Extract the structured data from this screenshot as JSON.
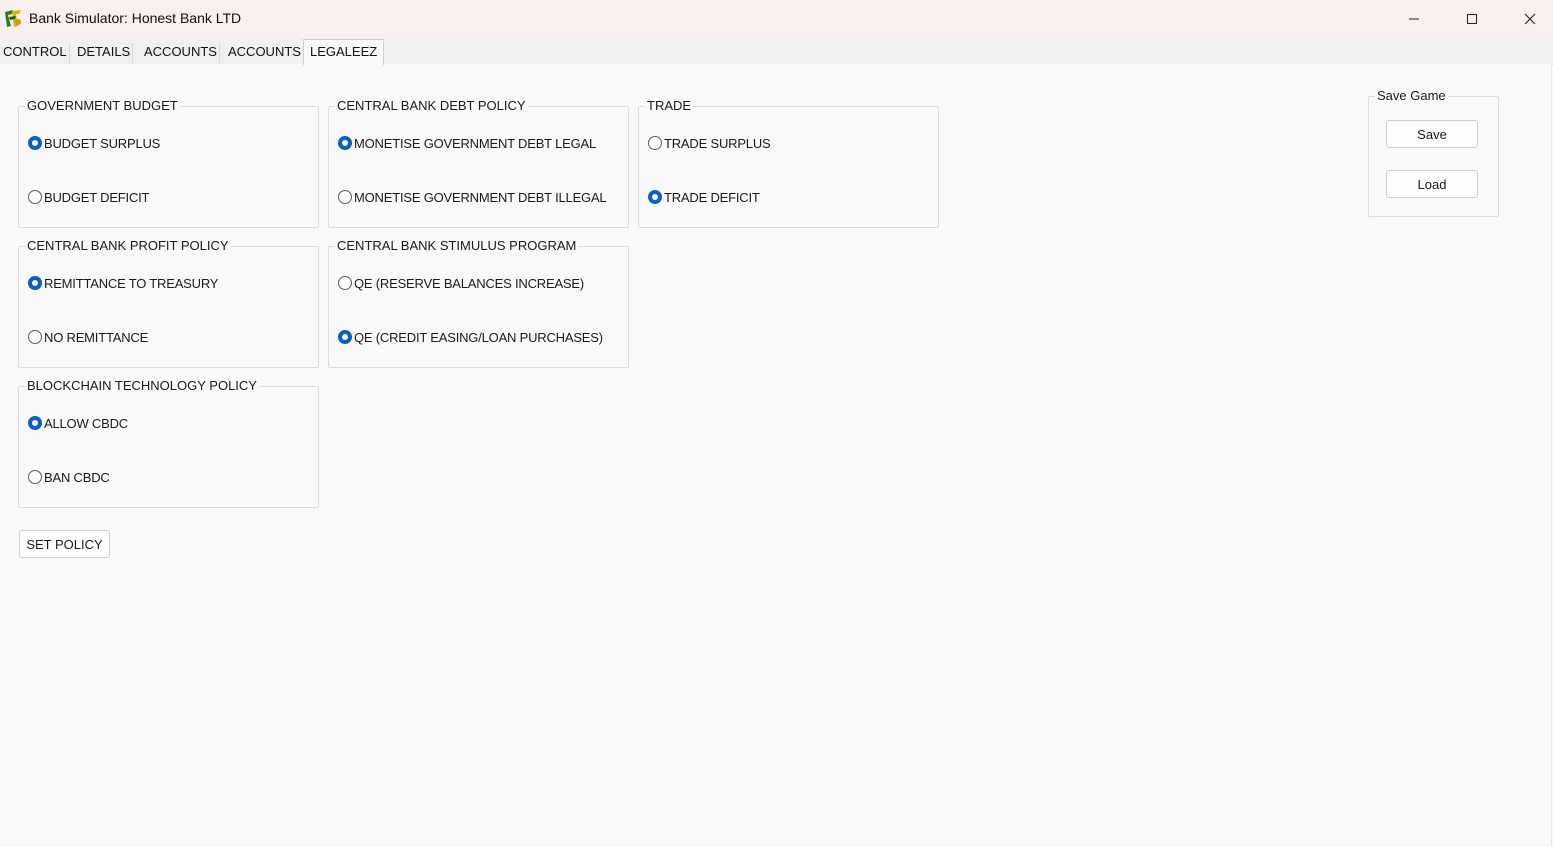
{
  "window": {
    "title": "Bank Simulator: Honest Bank LTD"
  },
  "tabs": [
    {
      "label": "CONTROL"
    },
    {
      "label": "DETAILS"
    },
    {
      "label": "ACCOUNTS"
    },
    {
      "label": "ACCOUNTS"
    },
    {
      "label": "LEGALEEZ",
      "active": true
    }
  ],
  "groups": {
    "government_budget": {
      "title": "GOVERNMENT BUDGET",
      "options": [
        {
          "label": "BUDGET SURPLUS",
          "checked": true
        },
        {
          "label": "BUDGET DEFICIT",
          "checked": false
        }
      ]
    },
    "central_bank_debt_policy": {
      "title": "CENTRAL BANK DEBT POLICY",
      "options": [
        {
          "label": "MONETISE GOVERNMENT DEBT LEGAL",
          "checked": true
        },
        {
          "label": "MONETISE GOVERNMENT DEBT ILLEGAL",
          "checked": false
        }
      ]
    },
    "trade": {
      "title": "TRADE",
      "options": [
        {
          "label": "TRADE SURPLUS",
          "checked": false
        },
        {
          "label": "TRADE DEFICIT",
          "checked": true
        }
      ]
    },
    "central_bank_profit_policy": {
      "title": "CENTRAL BANK PROFIT POLICY",
      "options": [
        {
          "label": "REMITTANCE TO TREASURY",
          "checked": true
        },
        {
          "label": "NO REMITTANCE",
          "checked": false
        }
      ]
    },
    "central_bank_stimulus_program": {
      "title": "CENTRAL BANK STIMULUS PROGRAM",
      "options": [
        {
          "label": "QE (RESERVE BALANCES INCREASE)",
          "checked": false
        },
        {
          "label": "QE (CREDIT EASING/LOAN PURCHASES)",
          "checked": true
        }
      ]
    },
    "blockchain_technology_policy": {
      "title": "BLOCKCHAIN TECHNOLOGY POLICY",
      "options": [
        {
          "label": "ALLOW CBDC",
          "checked": true
        },
        {
          "label": "BAN CBDC",
          "checked": false
        }
      ]
    },
    "save_game": {
      "title": "Save Game",
      "save_label": "Save",
      "load_label": "Load"
    }
  },
  "actions": {
    "set_policy_label": "SET POLICY"
  },
  "colors": {
    "accent": "#0a5fc2",
    "titlebar_bg": "#f9efef",
    "content_bg": "#f9f9f9"
  },
  "icons": {
    "app": "bank-simulator-logo-icon",
    "minimize": "minimize-icon",
    "maximize": "maximize-icon",
    "close": "close-icon"
  }
}
